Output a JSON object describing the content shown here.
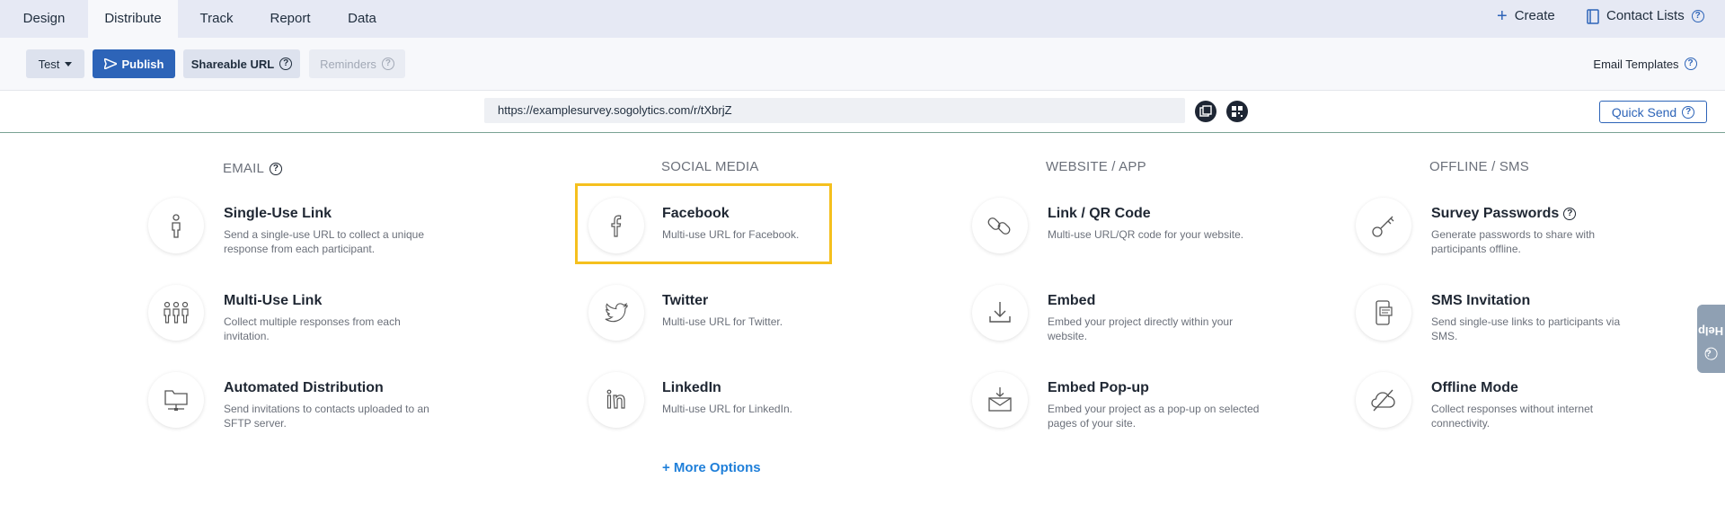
{
  "tabs": [
    "Design",
    "Distribute",
    "Track",
    "Report",
    "Data"
  ],
  "top_right": {
    "create": "Create",
    "contact_lists": "Contact Lists"
  },
  "toolbar": {
    "test": "Test",
    "publish": "Publish",
    "shareable_url": "Shareable URL",
    "reminders": "Reminders",
    "email_templates": "Email Templates"
  },
  "url": {
    "value": "https://examplesurvey.sogolytics.com/r/tXbrjZ",
    "quick_send": "Quick Send"
  },
  "columns": {
    "email": {
      "heading": "EMAIL",
      "items": [
        {
          "title": "Single-Use Link",
          "desc": "Send a single-use URL to collect a unique response from each participant.",
          "icon": "person-icon"
        },
        {
          "title": "Multi-Use Link",
          "desc": "Collect multiple responses from each invitation.",
          "icon": "people-icon"
        },
        {
          "title": "Automated Distribution",
          "desc": "Send invitations to contacts uploaded to an SFTP server.",
          "icon": "folder-network-icon"
        }
      ]
    },
    "social": {
      "heading": "SOCIAL MEDIA",
      "items": [
        {
          "title": "Facebook",
          "desc": "Multi-use URL for Facebook.",
          "icon": "facebook-icon"
        },
        {
          "title": "Twitter",
          "desc": "Multi-use URL for Twitter.",
          "icon": "twitter-icon"
        },
        {
          "title": "LinkedIn",
          "desc": "Multi-use URL for LinkedIn.",
          "icon": "linkedin-icon"
        }
      ]
    },
    "web": {
      "heading": "WEBSITE / APP",
      "items": [
        {
          "title": "Link / QR Code",
          "desc": "Multi-use URL/QR code for your website.",
          "icon": "link-icon"
        },
        {
          "title": "Embed",
          "desc": "Embed your project directly within your website.",
          "icon": "download-icon"
        },
        {
          "title": "Embed Pop-up",
          "desc": "Embed your project as a pop-up on selected pages of your site.",
          "icon": "envelope-download-icon"
        }
      ]
    },
    "offline": {
      "heading": "OFFLINE / SMS",
      "items": [
        {
          "title": "Survey Passwords",
          "desc": "Generate passwords to share with participants offline.",
          "icon": "key-icon"
        },
        {
          "title": "SMS Invitation",
          "desc": "Send single-use links to participants via SMS.",
          "icon": "phone-message-icon"
        },
        {
          "title": "Offline Mode",
          "desc": "Collect responses without internet connectivity.",
          "icon": "cloud-off-icon"
        }
      ]
    }
  },
  "more_options": "+ More Options",
  "help": "Help"
}
